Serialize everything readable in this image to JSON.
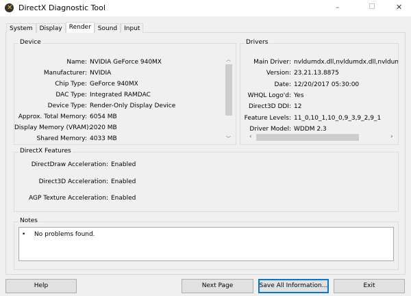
{
  "window": {
    "title": "DirectX Diagnostic Tool",
    "minimize": "–",
    "maximize": "☐",
    "close": "✕"
  },
  "tabs": [
    {
      "label": "System"
    },
    {
      "label": "Display"
    },
    {
      "label": "Render"
    },
    {
      "label": "Sound"
    },
    {
      "label": "Input"
    }
  ],
  "device": {
    "title": "Device",
    "rows": [
      {
        "label": "Name:",
        "value": "NVIDIA GeForce 940MX"
      },
      {
        "label": "Manufacturer:",
        "value": "NVIDIA"
      },
      {
        "label": "Chip Type:",
        "value": "GeForce 940MX"
      },
      {
        "label": "DAC Type:",
        "value": "Integrated RAMDAC"
      },
      {
        "label": "Device Type:",
        "value": "Render-Only Display Device"
      },
      {
        "label": "Approx. Total Memory:",
        "value": "6054 MB"
      },
      {
        "label": "Display Memory (VRAM):",
        "value": "2020 MB"
      },
      {
        "label": "Shared Memory:",
        "value": "4033 MB"
      }
    ]
  },
  "drivers": {
    "title": "Drivers",
    "rows": [
      {
        "label": "Main Driver:",
        "value": "nvldumdx.dll,nvldumdx.dll,nvldumdx.d"
      },
      {
        "label": "Version:",
        "value": "23.21.13.8875"
      },
      {
        "label": "Date:",
        "value": "12/20/2017 05:30:00"
      },
      {
        "label": "WHQL Logo'd:",
        "value": "Yes"
      },
      {
        "label": "Direct3D DDI:",
        "value": "12"
      },
      {
        "label": "Feature Levels:",
        "value": "11_0,10_1,10_0,9_3,9_2,9_1"
      },
      {
        "label": "Driver Model:",
        "value": "WDDM 2.3"
      }
    ]
  },
  "features": {
    "title": "DirectX Features",
    "rows": [
      {
        "label": "DirectDraw Acceleration:",
        "value": "Enabled"
      },
      {
        "label": "Direct3D Acceleration:",
        "value": "Enabled"
      },
      {
        "label": "AGP Texture Acceleration:",
        "value": "Enabled"
      }
    ]
  },
  "notes": {
    "title": "Notes",
    "bullet": "•",
    "items": [
      "No problems found."
    ]
  },
  "buttons": {
    "help": "Help",
    "next": "Next Page",
    "save": "Save All Information...",
    "exit": "Exit"
  }
}
